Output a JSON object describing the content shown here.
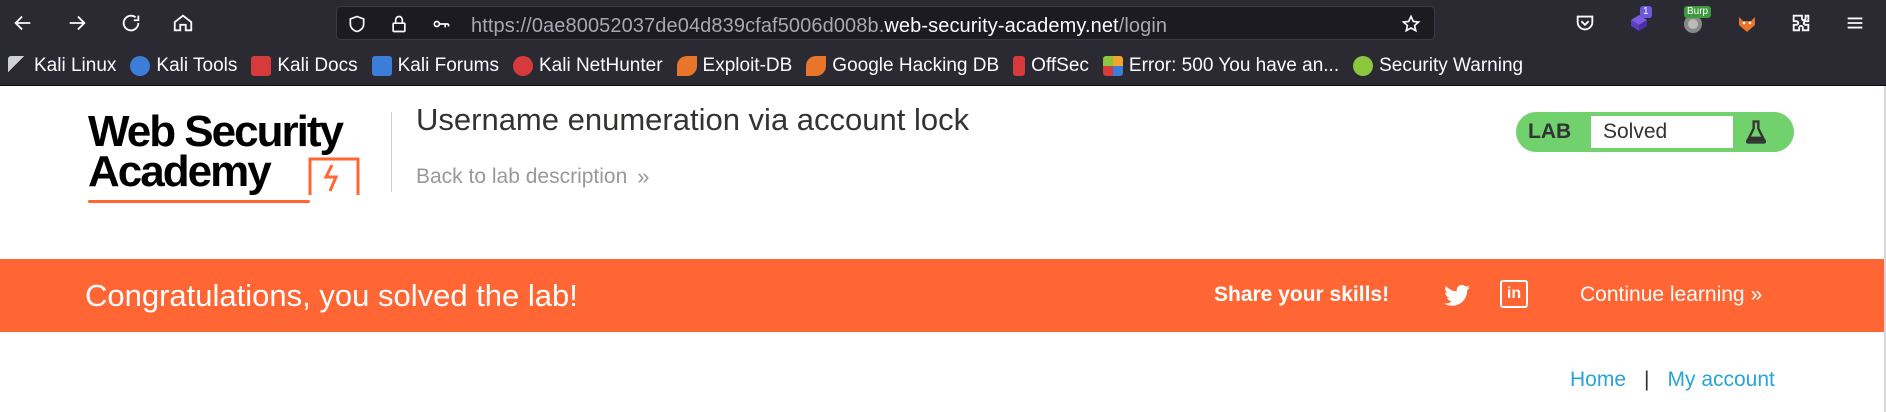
{
  "browser": {
    "url_prefix": "https://0ae80052037de04d839cfaf5006d008b.",
    "url_host": "web-security-academy.net",
    "url_path": "/login",
    "extension_badge_count": "1",
    "burp_badge": "Burp"
  },
  "bookmarks": [
    {
      "label": "Kali Linux",
      "icon": "kali-dragon-icon",
      "color": "#cfd3d8"
    },
    {
      "label": "Kali Tools",
      "icon": "kali-tools-icon",
      "color": "#3b7dd8"
    },
    {
      "label": "Kali Docs",
      "icon": "kali-docs-icon",
      "color": "#d63a3a"
    },
    {
      "label": "Kali Forums",
      "icon": "kali-forums-icon",
      "color": "#3b7dd8"
    },
    {
      "label": "Kali NetHunter",
      "icon": "nethunter-icon",
      "color": "#d63a3a"
    },
    {
      "label": "Exploit-DB",
      "icon": "exploit-db-icon",
      "color": "#e8762a"
    },
    {
      "label": "Google Hacking DB",
      "icon": "ghdb-icon",
      "color": "#e8762a"
    },
    {
      "label": "OffSec",
      "icon": "offsec-icon",
      "color": "#d63a3a"
    },
    {
      "label": "Error: 500 You have an...",
      "icon": "joomla-icon",
      "color": "#f4a62a"
    },
    {
      "label": "Security Warning",
      "icon": "security-warning-icon",
      "color": "#8cc63e"
    }
  ],
  "header": {
    "logo_line1": "Web Security",
    "logo_line2": "Academy",
    "lab_title": "Username enumeration via account lock",
    "back_link": "Back to lab description",
    "lab_label": "LAB",
    "lab_status": "Solved"
  },
  "banner": {
    "congrats": "Congratulations, you solved the lab!",
    "share": "Share your skills!",
    "continue": "Continue learning"
  },
  "nav": {
    "home": "Home",
    "separator": "|",
    "account": "My account"
  },
  "colors": {
    "accent": "#ff6633",
    "lab_green": "#70d16d",
    "link": "#29a3d8"
  }
}
